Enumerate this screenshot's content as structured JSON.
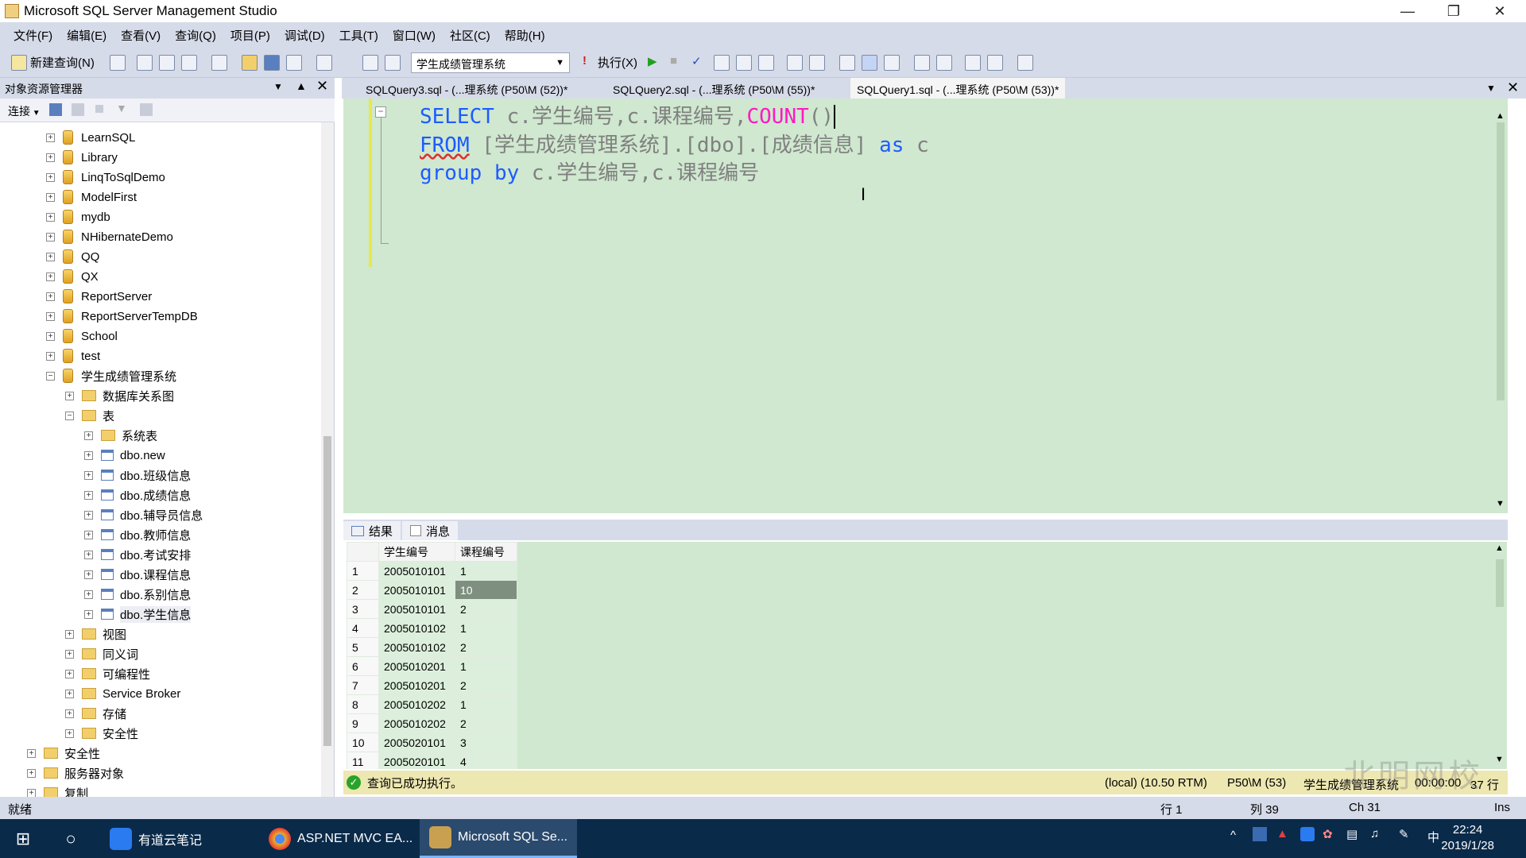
{
  "window": {
    "title": "Microsoft SQL Server Management Studio"
  },
  "menu": [
    "文件(F)",
    "编辑(E)",
    "查看(V)",
    "查询(Q)",
    "项目(P)",
    "调试(D)",
    "工具(T)",
    "窗口(W)",
    "社区(C)",
    "帮助(H)"
  ],
  "toolbar": {
    "new_query": "新建查询(N)",
    "database": "学生成绩管理系统",
    "execute": "执行(X)"
  },
  "object_explorer": {
    "title": "对象资源管理器",
    "connect": "连接",
    "databases": [
      "LearnSQL",
      "Library",
      "LinqToSqlDemo",
      "ModelFirst",
      "mydb",
      "NHibernateDemo",
      "QQ",
      "QX",
      "ReportServer",
      "ReportServerTempDB",
      "School",
      "test"
    ],
    "expanded_db": "学生成绩管理系统",
    "db_children": {
      "diagrams": "数据库关系图",
      "tables": "表"
    },
    "table_children": [
      "系统表",
      "dbo.new",
      "dbo.班级信息",
      "dbo.成绩信息",
      "dbo.辅导员信息",
      "dbo.教师信息",
      "dbo.考试安排",
      "dbo.课程信息",
      "dbo.系别信息",
      "dbo.学生信息"
    ],
    "db_folders": [
      "视图",
      "同义词",
      "可编程性",
      "Service Broker",
      "存储",
      "安全性"
    ],
    "server_folders": [
      "安全性",
      "服务器对象",
      "复制"
    ]
  },
  "tabs": [
    {
      "label": "SQLQuery3.sql - (...理系统 (P50\\M (52))*"
    },
    {
      "label": "SQLQuery2.sql - (...理系统 (P50\\M (55))*"
    },
    {
      "label": "SQLQuery1.sql - (...理系统 (P50\\M (53))*"
    }
  ],
  "editor": {
    "line1": {
      "kw": "SELECT",
      "a": " c.学生编号,c.课程编号,",
      "fn": "COUNT",
      "b": "()"
    },
    "line2": {
      "kw": "FROM",
      "a": " [学生成绩管理系统].[dbo].[成绩信息] ",
      "kw2": "as",
      "b": " c"
    },
    "line3": {
      "kw": "group",
      "s": " ",
      "kw2": "by",
      "a": " c.学生编号,c.课程编号"
    }
  },
  "results": {
    "tabs": [
      "结果",
      "消息"
    ],
    "columns": [
      "学生编号",
      "课程编号"
    ],
    "rows": [
      [
        "1",
        "2005010101",
        "1"
      ],
      [
        "2",
        "2005010101",
        "10"
      ],
      [
        "3",
        "2005010101",
        "2"
      ],
      [
        "4",
        "2005010102",
        "1"
      ],
      [
        "5",
        "2005010102",
        "2"
      ],
      [
        "6",
        "2005010201",
        "1"
      ],
      [
        "7",
        "2005010201",
        "2"
      ],
      [
        "8",
        "2005010202",
        "1"
      ],
      [
        "9",
        "2005010202",
        "2"
      ],
      [
        "10",
        "2005020101",
        "3"
      ],
      [
        "11",
        "2005020101",
        "4"
      ]
    ]
  },
  "query_status": {
    "message": "查询已成功执行。",
    "server": "(local) (10.50 RTM)",
    "user": "P50\\M (53)",
    "db": "学生成绩管理系统",
    "time": "00:00:00",
    "rows": "37 行"
  },
  "statusbar": {
    "ready": "就绪",
    "line": "行 1",
    "col": "列 39",
    "ch": "Ch 31",
    "mode": "Ins"
  },
  "taskbar": {
    "apps": [
      "有道云笔记",
      "ASP.NET MVC EA...",
      "Microsoft SQL Se..."
    ],
    "ime": "中",
    "time": "22:24",
    "date": "2019/1/28"
  },
  "watermark": "北明网校"
}
